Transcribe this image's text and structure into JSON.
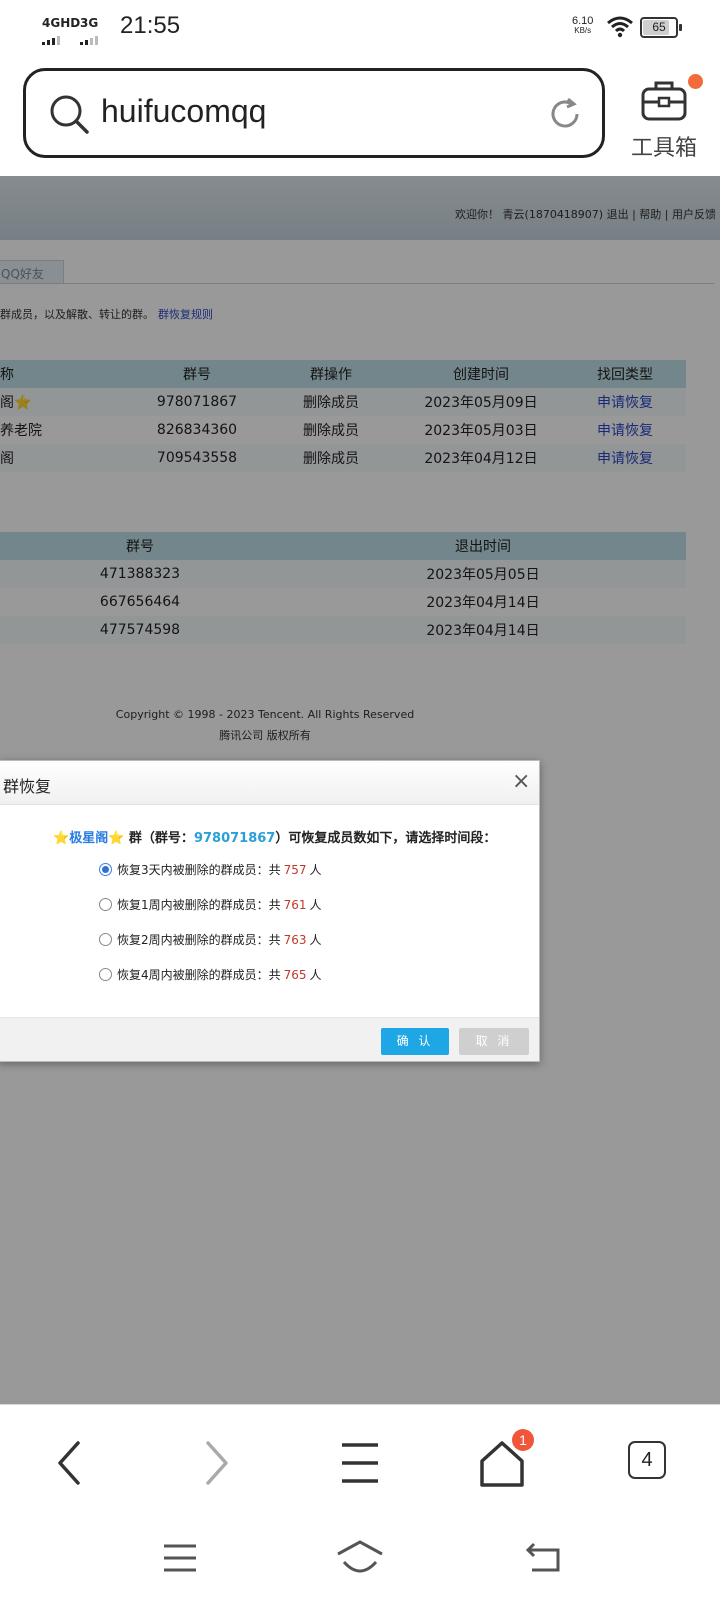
{
  "status_bar": {
    "sim1": "4GHD",
    "sim2": "3G",
    "time": "21:55",
    "net_speed": "6.10",
    "net_speed_unit": "KB/s",
    "battery": "65"
  },
  "search": {
    "query": "huifucomqq",
    "toolbox_label": "工具箱"
  },
  "page": {
    "welcome": "欢迎你！ 青云(1870418907) 退出 | 帮助 | 用户反馈",
    "tab_label": "QQ好友",
    "notice": "群成员，以及解散、转让的群。",
    "notice_link": "群恢复规则",
    "groups_table": {
      "headers": [
        "称",
        "群号",
        "群操作",
        "创建时间",
        "找回类型"
      ],
      "rows": [
        {
          "name": "阁",
          "star": "⭐",
          "number": "978071867",
          "op": "删除成员",
          "created": "2023年05月09日",
          "action": "申请恢复"
        },
        {
          "name": "养老院",
          "star": "",
          "number": "826834360",
          "op": "删除成员",
          "created": "2023年05月03日",
          "action": "申请恢复"
        },
        {
          "name": "阁",
          "star": "",
          "number": "709543558",
          "op": "删除成员",
          "created": "2023年04月12日",
          "action": "申请恢复"
        }
      ]
    },
    "exit_table": {
      "headers": [
        "群号",
        "退出时间"
      ],
      "rows": [
        {
          "number": "471388323",
          "time": "2023年05月05日"
        },
        {
          "number": "667656464",
          "time": "2023年04月14日"
        },
        {
          "number": "477574598",
          "time": "2023年04月14日"
        }
      ]
    },
    "copyright": "Copyright © 1998 - 2023 Tencent. All Rights Reserved",
    "copyright_cn": "腾讯公司 版权所有"
  },
  "dialog": {
    "title": "群恢复",
    "close": "×",
    "star": "⭐",
    "group_name": "极星阁",
    "q_prefix": "群（群号：",
    "group_number": "978071867",
    "q_suffix": "）可恢复成员数如下，请选择时间段：",
    "options": [
      {
        "label": "恢复3天内被删除的群成员：共",
        "count": "757",
        "unit": "人",
        "selected": true
      },
      {
        "label": "恢复1周内被删除的群成员：共",
        "count": "761",
        "unit": "人",
        "selected": false
      },
      {
        "label": "恢复2周内被删除的群成员：共",
        "count": "763",
        "unit": "人",
        "selected": false
      },
      {
        "label": "恢复4周内被删除的群成员：共",
        "count": "765",
        "unit": "人",
        "selected": false
      }
    ],
    "confirm": "确 认",
    "cancel": "取 消"
  },
  "bottom_nav": {
    "home_badge": "1",
    "tab_count": "4"
  },
  "colors": {
    "overlay": "#000000",
    "table_header": "#bfe0e9",
    "confirm_button": "#1ea7e4",
    "link": "#2b45c6",
    "badge": "#f0573a"
  }
}
